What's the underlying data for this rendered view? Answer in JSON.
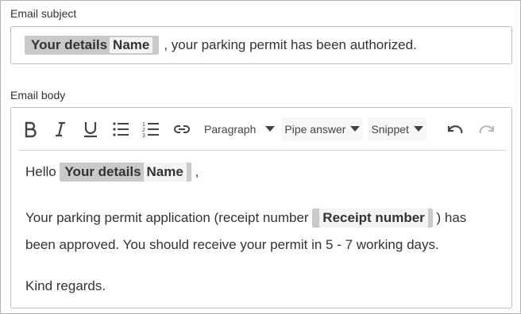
{
  "subject": {
    "label": "Email subject",
    "pipe_group": "Your details",
    "pipe_field": "Name",
    "trailing_text": ", your parking permit has been authorized."
  },
  "body": {
    "label": "Email body",
    "toolbar": {
      "bold_icon": "bold-icon",
      "italic_icon": "italic-icon",
      "underline_icon": "underline-icon",
      "bulleted_list_icon": "bulleted-list-icon",
      "numbered_list_icon": "numbered-list-icon",
      "link_icon": "link-icon",
      "paragraph_label": "Paragraph",
      "pipe_answer_label": "Pipe answer",
      "snippet_label": "Snippet",
      "undo_icon": "undo-icon",
      "redo_icon": "redo-icon"
    },
    "greeting": "Hello",
    "greeting_pipe_group": "Your details",
    "greeting_pipe_field": "Name",
    "greeting_suffix": ",",
    "para1_before": "Your parking permit application (receipt number",
    "para1_pipe": "Receipt number",
    "para1_after": ") has",
    "para1_line2": "been approved. You should receive your permit in 5 - 7 working days.",
    "closing": "Kind regards."
  }
}
